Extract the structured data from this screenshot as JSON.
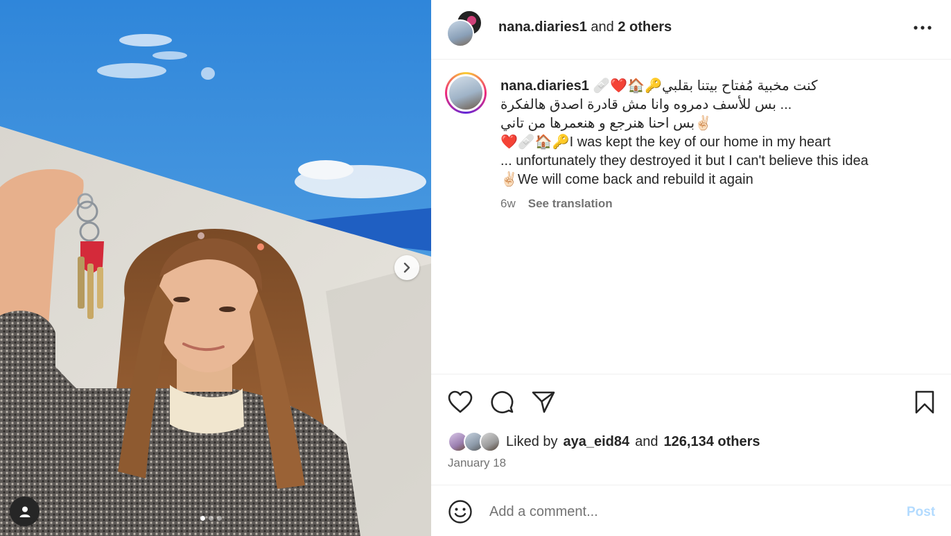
{
  "photo": {
    "alt": "",
    "carousel": {
      "total": 3,
      "active_index": 0
    }
  },
  "icons": {
    "next": "chevron-right-icon",
    "user_tag": "user-tag-icon",
    "more": "more-options-icon",
    "like": "heart-icon",
    "comment": "comment-icon",
    "share": "share-icon",
    "save": "bookmark-icon",
    "emoji": "emoji-icon"
  },
  "header": {
    "username": "nana.diaries1",
    "and_text": "and",
    "others": "2 others"
  },
  "caption": {
    "username": "nana.diaries1",
    "lines": [
      "🩹❤️🏠🔑كنت مخبية مُفتاح بيتنا بقلبي",
      "بس للأسف دمروه وانا مش قادرة اصدق هالفكرة ...",
      "بس احنا هنرجع و هنعمرها من تاني✌🏻",
      "❤️🩹🏠🔑I was kept the key of our home in my heart",
      "... unfortunately they destroyed it but I can't believe this idea",
      "✌🏻We will come back and rebuild it again"
    ],
    "age": "6w",
    "see_translation": "See translation"
  },
  "likes": {
    "prefix": "Liked by",
    "user": "aya_eid84",
    "and_text": "and",
    "count_text": "126,134 others"
  },
  "date": "January 18",
  "comment": {
    "placeholder": "Add a comment...",
    "post_label": "Post"
  },
  "colors": {
    "text": "#262626",
    "secondary": "#737373",
    "divider": "#efefef",
    "post_disabled": "#b3dbff"
  }
}
